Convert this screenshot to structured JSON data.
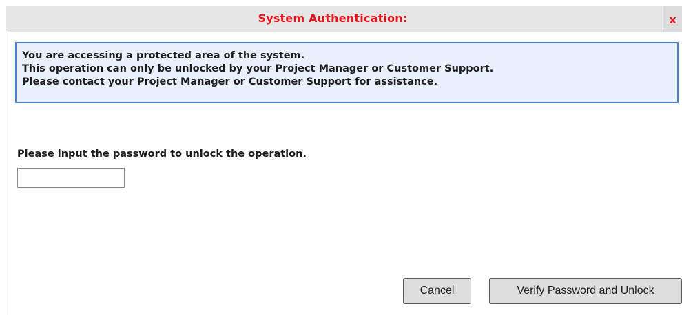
{
  "dialog": {
    "title": "System Authentication:",
    "close_label": "x"
  },
  "info": {
    "lines": [
      "You are accessing a protected area of the system.",
      "This operation can only be unlocked by your Project Manager or Customer Support.",
      "Please contact your Project Manager or Customer Support for assistance."
    ]
  },
  "form": {
    "prompt": "Please input the password to unlock the operation.",
    "password_value": "",
    "password_placeholder": ""
  },
  "buttons": {
    "cancel_label": "Cancel",
    "verify_label": "Verify Password and Unlock"
  },
  "colors": {
    "title_text": "#e8141c",
    "info_border": "#4a80c4",
    "info_background": "#e8f1fb",
    "button_background": "#dedede"
  }
}
